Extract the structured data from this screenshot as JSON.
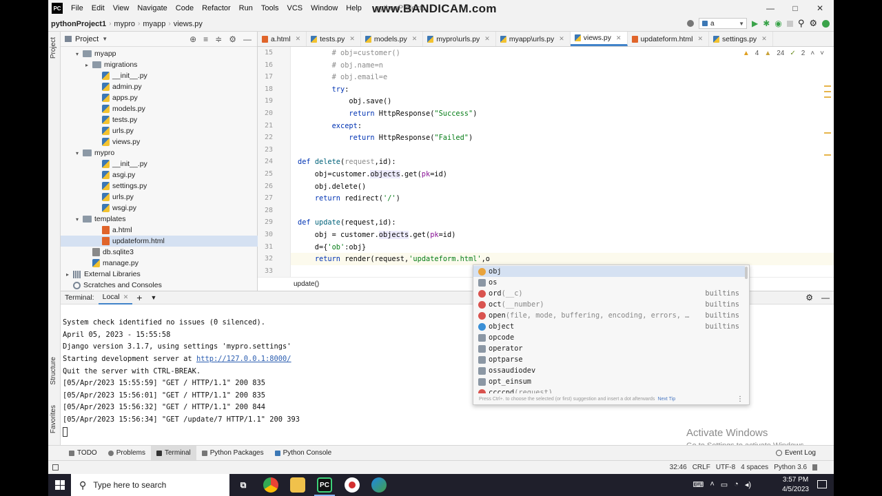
{
  "titlebar": {
    "logo": "PC",
    "menus": [
      "File",
      "Edit",
      "View",
      "Navigate",
      "Code",
      "Refactor",
      "Run",
      "Tools",
      "VCS",
      "Window",
      "Help"
    ],
    "project_title": "pythonProject1",
    "watermark": "www.BANDICAM.com"
  },
  "navbar": {
    "crumbs": [
      "pythonProject1",
      "mypro",
      "myapp",
      "views.py"
    ],
    "run_config": "a"
  },
  "toolstrip": {
    "project": "Project",
    "structure": "Structure",
    "favorites": "Favorites"
  },
  "project_panel": {
    "title": "Project",
    "items": [
      {
        "label": "myapp",
        "type": "folder",
        "arrow": "▾"
      },
      {
        "label": "migrations",
        "type": "folder",
        "arrow": "▸"
      },
      {
        "label": "__init__.py",
        "type": "py"
      },
      {
        "label": "admin.py",
        "type": "py"
      },
      {
        "label": "apps.py",
        "type": "py"
      },
      {
        "label": "models.py",
        "type": "py"
      },
      {
        "label": "tests.py",
        "type": "py"
      },
      {
        "label": "urls.py",
        "type": "py"
      },
      {
        "label": "views.py",
        "type": "py"
      },
      {
        "label": "mypro",
        "type": "folder",
        "arrow": "▾"
      },
      {
        "label": "__init__.py",
        "type": "py"
      },
      {
        "label": "asgi.py",
        "type": "py"
      },
      {
        "label": "settings.py",
        "type": "py"
      },
      {
        "label": "urls.py",
        "type": "py"
      },
      {
        "label": "wsgi.py",
        "type": "py"
      },
      {
        "label": "templates",
        "type": "folder",
        "arrow": "▾"
      },
      {
        "label": "a.html",
        "type": "html"
      },
      {
        "label": "updateform.html",
        "type": "html",
        "selected": true
      },
      {
        "label": "db.sqlite3",
        "type": "db"
      },
      {
        "label": "manage.py",
        "type": "py"
      },
      {
        "label": "External Libraries",
        "type": "lib",
        "arrow": "▸"
      },
      {
        "label": "Scratches and Consoles",
        "type": "scratch"
      }
    ]
  },
  "tabs": [
    {
      "label": "a.html",
      "type": "html"
    },
    {
      "label": "tests.py",
      "type": "py"
    },
    {
      "label": "models.py",
      "type": "py"
    },
    {
      "label": "mypro\\urls.py",
      "type": "py"
    },
    {
      "label": "myapp\\urls.py",
      "type": "py"
    },
    {
      "label": "views.py",
      "type": "py",
      "active": true
    },
    {
      "label": "updateform.html",
      "type": "html"
    },
    {
      "label": "settings.py",
      "type": "py"
    }
  ],
  "inspections": {
    "warnings": "4",
    "weak": "24",
    "typos": "2"
  },
  "editor": {
    "lines": [
      {
        "n": "15",
        "html": "        <span class=\"cmt\"># obj=customer()</span>"
      },
      {
        "n": "16",
        "html": "        <span class=\"cmt\"># obj.name=n</span>"
      },
      {
        "n": "17",
        "html": "        <span class=\"cmt\"># obj.email=e</span>"
      },
      {
        "n": "18",
        "html": "        <span class=\"kw\">try</span>:"
      },
      {
        "n": "19",
        "html": "            obj.save()"
      },
      {
        "n": "20",
        "html": "            <span class=\"kw\">return</span> HttpResponse(<span class=\"str\">\"Success\"</span>)"
      },
      {
        "n": "21",
        "html": "        <span class=\"kw\">except</span>:"
      },
      {
        "n": "22",
        "html": "            <span class=\"kw\">return</span> HttpResponse(<span class=\"str\">\"Failed\"</span>)"
      },
      {
        "n": "23",
        "html": ""
      },
      {
        "n": "24",
        "html": "<span class=\"kw\">def</span> <span class=\"fn\">delete</span>(<span class=\"cmt\">request</span>,id):"
      },
      {
        "n": "25",
        "html": "    obj=customer.<span class=\"hl\">objects</span>.get(<span class=\"par\">pk</span>=id)"
      },
      {
        "n": "26",
        "html": "    obj.delete()"
      },
      {
        "n": "27",
        "html": "    <span class=\"kw\">return</span> redirect(<span class=\"str\">'/'</span>)"
      },
      {
        "n": "28",
        "html": ""
      },
      {
        "n": "29",
        "html": "<span class=\"kw\">def</span> <span class=\"fn\">update</span>(request,id):"
      },
      {
        "n": "30",
        "html": "    obj = customer.<span class=\"hl\">objects</span>.get(<span class=\"par\">pk</span>=id)"
      },
      {
        "n": "31",
        "html": "    d={<span class=\"str\">'ob'</span>:obj}"
      },
      {
        "n": "32",
        "html": "    <span class=\"kw\">return</span> render(request,<span class=\"str\">'updateform.html'</span>,o"
      },
      {
        "n": "33",
        "html": ""
      }
    ],
    "breadcrumb": "update()"
  },
  "autocomplete": {
    "items": [
      {
        "icon": "v",
        "label": "obj",
        "tail": "",
        "source": "",
        "selected": true
      },
      {
        "icon": "p",
        "label": "os",
        "tail": "",
        "source": ""
      },
      {
        "icon": "f",
        "label": "ord",
        "tail": "(__c)",
        "source": "builtins"
      },
      {
        "icon": "f",
        "label": "oct",
        "tail": "(__number)",
        "source": "builtins"
      },
      {
        "icon": "f",
        "label": "open",
        "tail": "(file, mode, buffering, encoding, errors, …",
        "source": "builtins"
      },
      {
        "icon": "c",
        "label": "object",
        "tail": "",
        "source": "builtins"
      },
      {
        "icon": "p",
        "label": "opcode",
        "tail": "",
        "source": ""
      },
      {
        "icon": "p",
        "label": "operator",
        "tail": "",
        "source": ""
      },
      {
        "icon": "p",
        "label": "optparse",
        "tail": "",
        "source": ""
      },
      {
        "icon": "p",
        "label": "ossaudiodev",
        "tail": "",
        "source": ""
      },
      {
        "icon": "p",
        "label": "opt_einsum",
        "tail": "",
        "source": ""
      },
      {
        "icon": "f",
        "label": "ссссрd",
        "tail": "(request)",
        "source": ""
      }
    ],
    "footer": "Press Ctrl+. to choose the selected (or first) suggestion and insert a dot afterwards",
    "footer_link": "Next Tip"
  },
  "terminal": {
    "label": "Terminal:",
    "tab": "Local",
    "lines": [
      "System check identified no issues (0 silenced).",
      "April 05, 2023 - 15:55:58",
      "Django version 3.1.7, using settings 'mypro.settings'",
      "Starting development server at ",
      "Quit the server with CTRL-BREAK.",
      "[05/Apr/2023 15:55:59] \"GET / HTTP/1.1\" 200 835",
      "[05/Apr/2023 15:56:01] \"GET / HTTP/1.1\" 200 835",
      "[05/Apr/2023 15:56:32] \"GET / HTTP/1.1\" 200 844",
      "[05/Apr/2023 15:56:34] \"GET /update/7 HTTP/1.1\" 200 393"
    ],
    "server_url": "http://127.0.0.1:8000/",
    "activate_title": "Activate Windows",
    "activate_sub": "Go to Settings to activate Windows."
  },
  "bottom_tabs": [
    "TODO",
    "Problems",
    "Terminal",
    "Python Packages",
    "Python Console"
  ],
  "event_log": "Event Log",
  "status": {
    "position": "32:46",
    "line_sep": "CRLF",
    "encoding": "UTF-8",
    "indent": "4 spaces",
    "interpreter": "Python 3.6"
  },
  "taskbar": {
    "search_placeholder": "Type here to search",
    "time": "3:57 PM",
    "date": "4/5/2023"
  }
}
